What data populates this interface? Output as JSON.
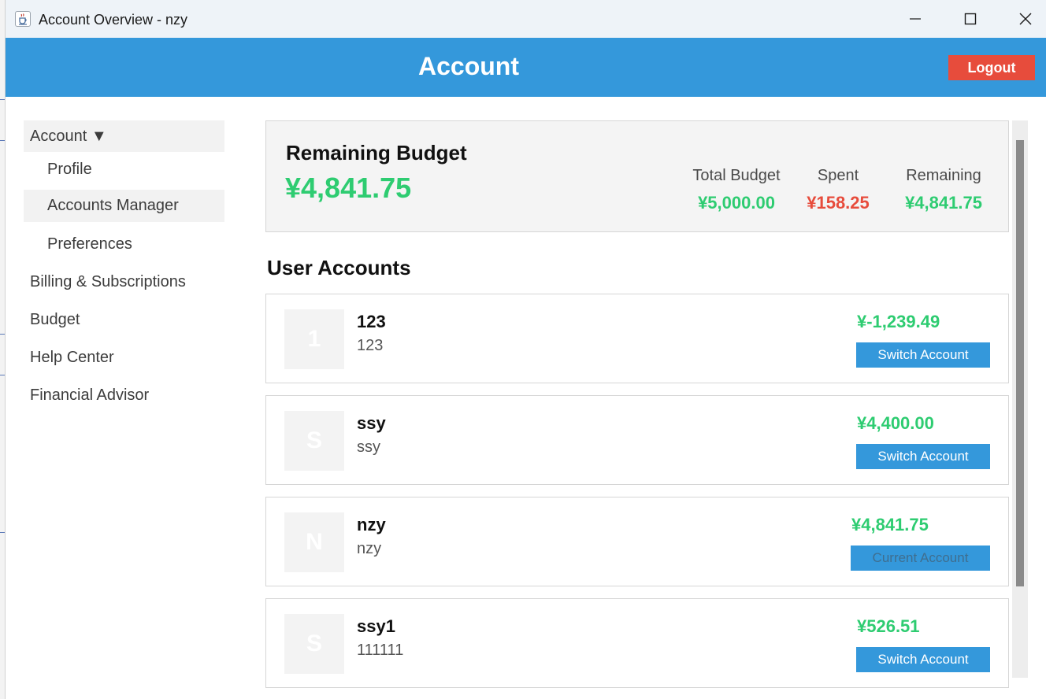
{
  "window": {
    "title": "Account Overview - nzy"
  },
  "header": {
    "title": "Account",
    "logout_label": "Logout"
  },
  "sidebar": {
    "items": [
      {
        "label": "Account ▼"
      },
      {
        "label": "Profile"
      },
      {
        "label": "Accounts Manager"
      },
      {
        "label": "Preferences"
      },
      {
        "label": "Billing & Subscriptions"
      },
      {
        "label": "Budget"
      },
      {
        "label": "Help Center"
      },
      {
        "label": "Financial Advisor"
      }
    ]
  },
  "budget": {
    "title": "Remaining Budget",
    "amount": "¥4,841.75",
    "stats": [
      {
        "label": "Total Budget",
        "value": "¥5,000.00"
      },
      {
        "label": "Spent",
        "value": "¥158.25"
      },
      {
        "label": "Remaining",
        "value": "¥4,841.75"
      }
    ]
  },
  "accounts": {
    "title": "User Accounts",
    "list": [
      {
        "avatar": "1",
        "name": "123",
        "sub": "123",
        "balance": "¥-1,239.49",
        "button": "Switch Account"
      },
      {
        "avatar": "S",
        "name": "ssy",
        "sub": "ssy",
        "balance": "¥4,400.00",
        "button": "Switch Account"
      },
      {
        "avatar": "N",
        "name": "nzy",
        "sub": "nzy",
        "balance": "¥4,841.75",
        "button": "Current Account"
      },
      {
        "avatar": "S",
        "name": "ssy1",
        "sub": "111111",
        "balance": "¥526.51",
        "button": "Switch Account"
      }
    ]
  },
  "colors": {
    "header": "#3498db",
    "logout": "#e74c3c",
    "positive": "#2ecc71",
    "negative": "#e74c3c",
    "button": "#3498db"
  },
  "icons": {
    "app": "java-cup-icon",
    "minimize": "minimize-icon",
    "maximize": "maximize-icon",
    "close": "close-icon"
  }
}
